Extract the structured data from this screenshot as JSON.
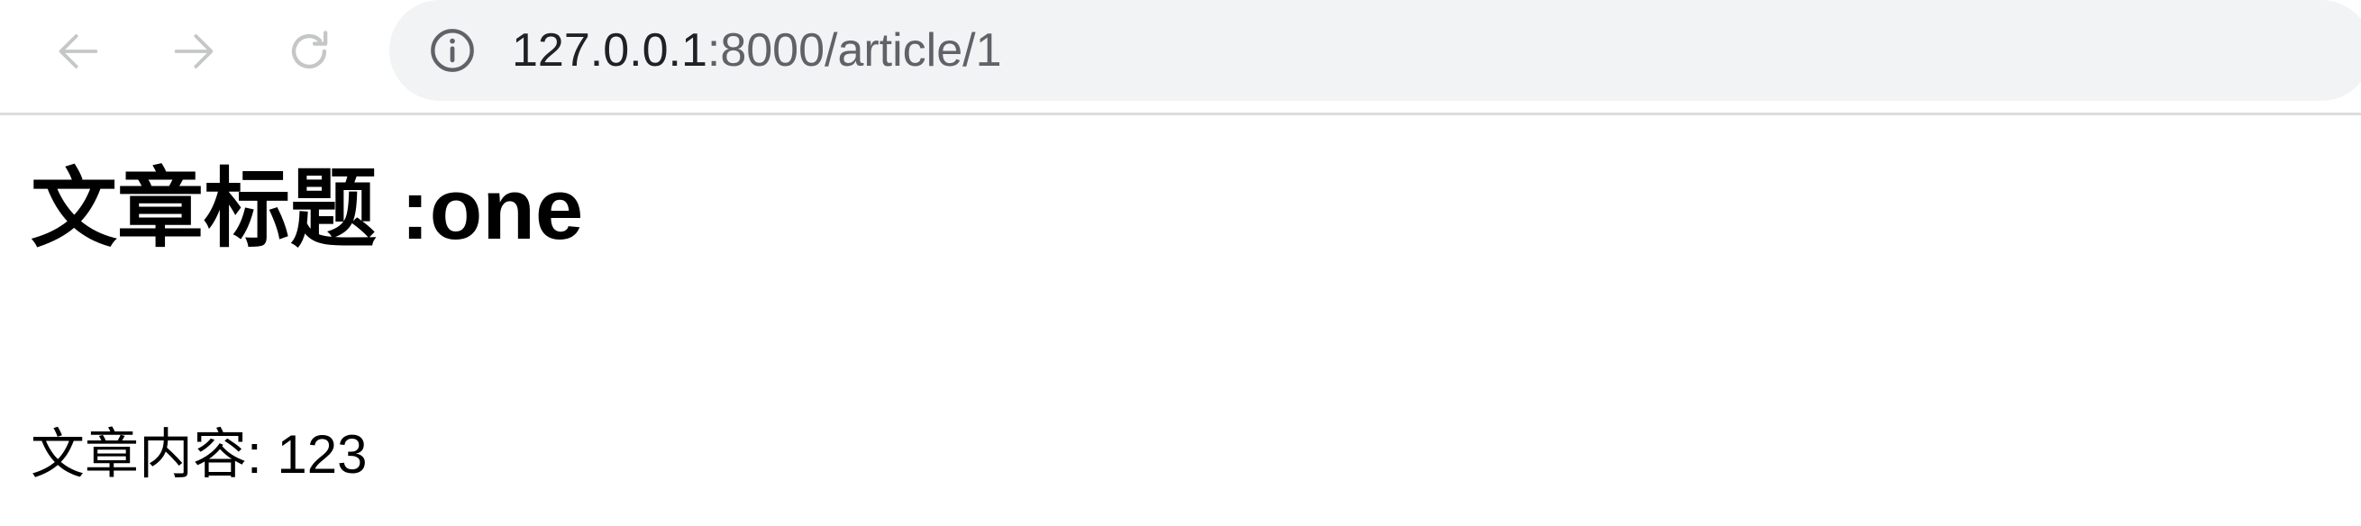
{
  "browser": {
    "url_host": "127.0.0.1",
    "url_path": ":8000/article/1",
    "icons": {
      "back": "arrow-left-icon",
      "forward": "arrow-right-icon",
      "reload": "reload-icon",
      "site_info": "info-icon"
    }
  },
  "page": {
    "title": "文章标题 :one",
    "content": "文章内容: 123"
  }
}
